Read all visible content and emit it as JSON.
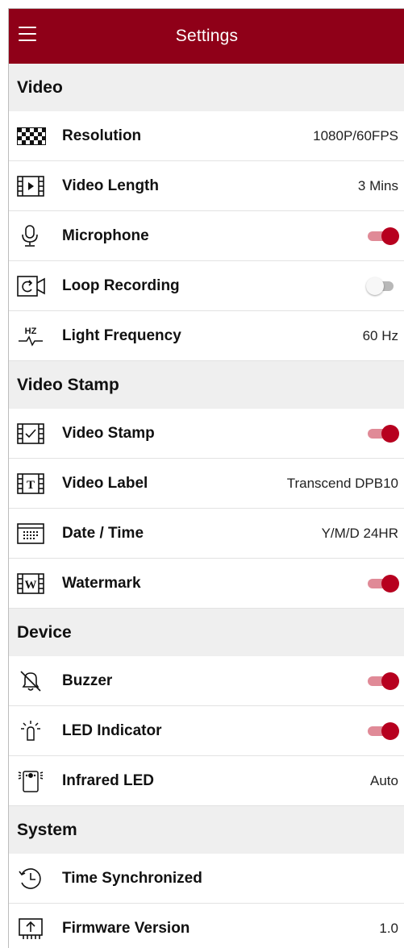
{
  "header": {
    "title": "Settings",
    "menu_icon": "hamburger-icon",
    "bar_color": "#8f0018"
  },
  "toggle_colors": {
    "on_knob": "#b7001f",
    "on_track": "#e08a97",
    "off_track": "#b8b8b8"
  },
  "sections": {
    "video": {
      "title": "Video",
      "resolution": {
        "label": "Resolution",
        "value": "1080P/60FPS",
        "icon": "resolution-grid-icon"
      },
      "video_length": {
        "label": "Video Length",
        "value": "3 Mins",
        "icon": "film-play-icon"
      },
      "microphone": {
        "label": "Microphone",
        "on": true,
        "icon": "microphone-icon"
      },
      "loop_recording": {
        "label": "Loop Recording",
        "on": false,
        "icon": "loop-camera-icon"
      },
      "light_frequency": {
        "label": "Light Frequency",
        "value": "60 Hz",
        "icon": "hz-wave-icon",
        "icon_text": "HZ"
      }
    },
    "video_stamp": {
      "title": "Video Stamp",
      "video_stamp": {
        "label": "Video Stamp",
        "on": true,
        "icon": "film-check-icon"
      },
      "video_label": {
        "label": "Video Label",
        "value": "Transcend DPB10",
        "icon": "film-text-icon",
        "icon_text": "T"
      },
      "date_time": {
        "label": "Date / Time",
        "value": "Y/M/D 24HR",
        "icon": "calendar-grid-icon"
      },
      "watermark": {
        "label": "Watermark",
        "on": true,
        "icon": "film-watermark-icon",
        "icon_text": "W"
      }
    },
    "device": {
      "title": "Device",
      "buzzer": {
        "label": "Buzzer",
        "on": true,
        "icon": "bell-muted-icon"
      },
      "led_indicator": {
        "label": "LED Indicator",
        "on": true,
        "icon": "led-bulb-icon"
      },
      "infrared_led": {
        "label": "Infrared LED",
        "value": "Auto",
        "icon": "infrared-camera-icon"
      }
    },
    "system": {
      "title": "System",
      "time_sync": {
        "label": "Time Synchronized",
        "icon": "clock-sync-icon"
      },
      "firmware": {
        "label": "Firmware Version",
        "value": "1.0",
        "icon": "firmware-upload-icon"
      }
    }
  }
}
